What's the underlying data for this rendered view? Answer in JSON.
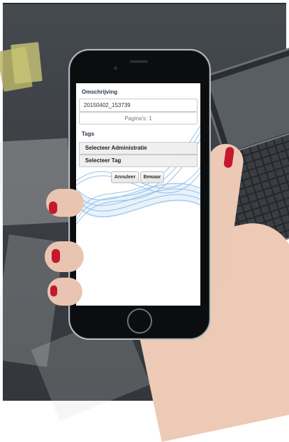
{
  "form": {
    "description_label": "Omschrijving",
    "description_value": "20150402_153739",
    "pages_text": "Pagina's: 1",
    "tags_label": "Tags",
    "select_administration": "Selecteer Administratie",
    "select_tag": "Selecteer Tag",
    "cancel_label": "Annuleer",
    "save_label": "Bewaar"
  },
  "colors": {
    "nail": "#c5182c",
    "label_text": "#2d3a4e",
    "wave": "#3f8fd6"
  },
  "icons": [
    "home-button-icon",
    "camera-icon",
    "speaker-icon"
  ]
}
